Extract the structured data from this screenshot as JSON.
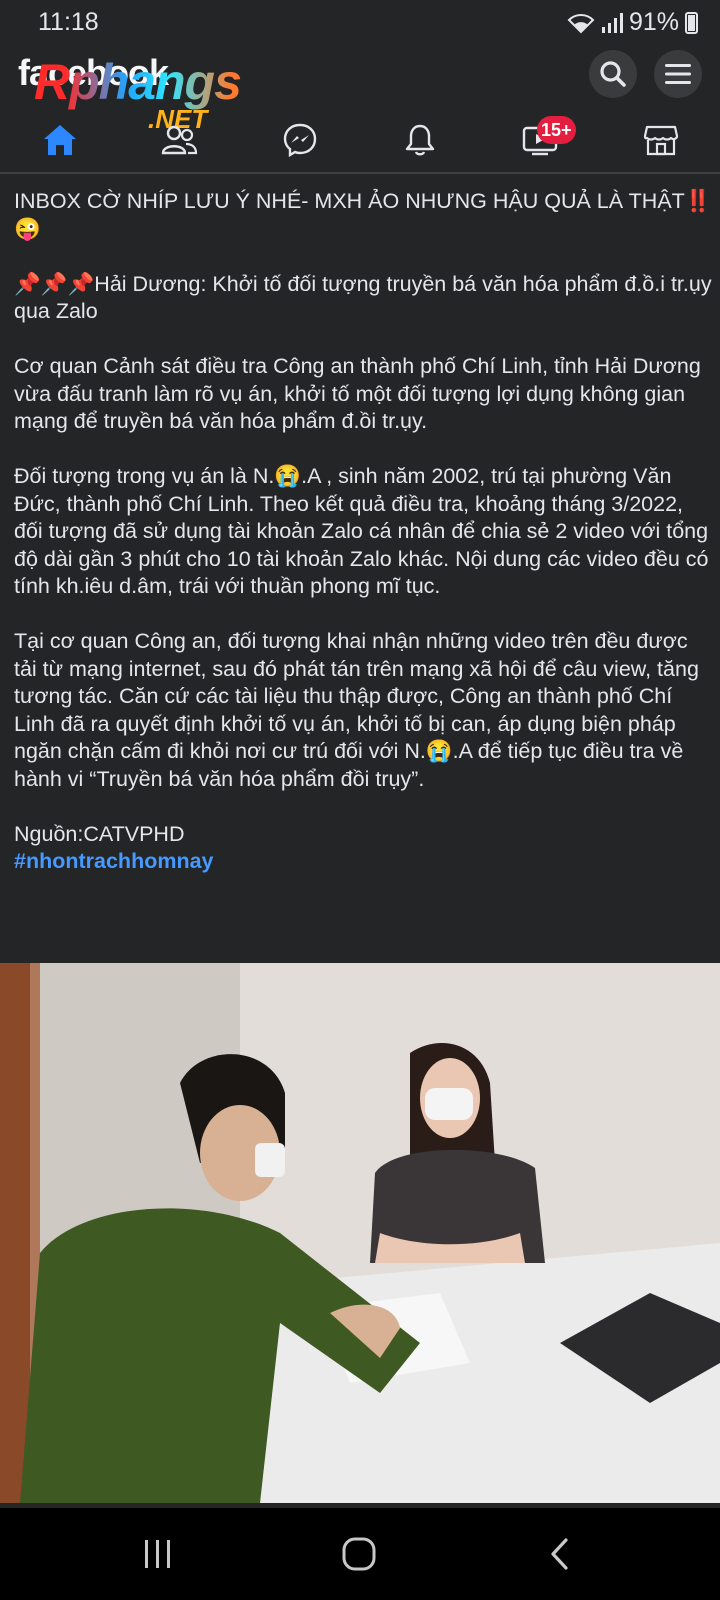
{
  "status_bar": {
    "time": "11:18",
    "battery": "91%"
  },
  "header": {
    "logo_fb": "facebook",
    "logo_overlay": "Rphangs",
    "logo_net": ".NET",
    "notifications_badge": "15+"
  },
  "post": {
    "paragraphs": [
      "INBOX CỜ NHÍP LƯU Ý NHÉ- MXH ẢO NHƯNG HẬU QUẢ LÀ THẬT‼️😜",
      "📌📌📌Hải Dương: Khởi tố đối tượng truyền bá văn hóa phẩm đ.ồ.i tr.ụy qua Zalo",
      " Cơ quan Cảnh sát điều tra Công an thành phố Chí Linh, tỉnh Hải Dương vừa đấu tranh làm rõ vụ án, khởi tố một đối tượng lợi dụng không gian mạng để truyền bá văn hóa phẩm đ.ồi tr.ụy.",
      "Đối tượng trong vụ án là N.😭.A , sinh năm 2002, trú tại phường Văn Đức, thành phố Chí Linh. Theo kết quả điều tra, khoảng tháng 3/2022, đối tượng đã sử dụng tài khoản Zalo cá nhân để chia sẻ 2 video với tổng độ dài gần 3 phút cho 10 tài khoản Zalo khác. Nội dung các video đều có tính kh.iêu d.âm, trái với thuần phong mĩ tục.",
      "Tại cơ quan Công an,  đối tượng khai nhận những video trên đều được tải từ mạng internet, sau đó phát tán trên mạng xã hội để câu view, tăng tương tác. Căn cứ các tài liệu thu thập được, Công an thành phố Chí Linh đã ra quyết định khởi tố vụ án, khởi tố bị can, áp dụng biện pháp ngăn chặn cấm đi khỏi nơi cư trú đối với N.😭.A để tiếp tục điều tra về hành vi  “Truyền bá văn hóa phẩm đồi trụy”."
    ],
    "source": " Nguồn:CATVPHD",
    "hashtag": "#nhontrachhomnay"
  },
  "icons": {
    "nav": [
      "home-icon",
      "friends-icon",
      "messenger-icon",
      "bell-icon",
      "watch-icon",
      "marketplace-icon"
    ],
    "header": [
      "search-icon",
      "menu-icon"
    ]
  },
  "colors": {
    "background": "#242526",
    "accent": "#2d88ff",
    "badge": "#e41e3f",
    "hashtag": "#4599ff"
  }
}
